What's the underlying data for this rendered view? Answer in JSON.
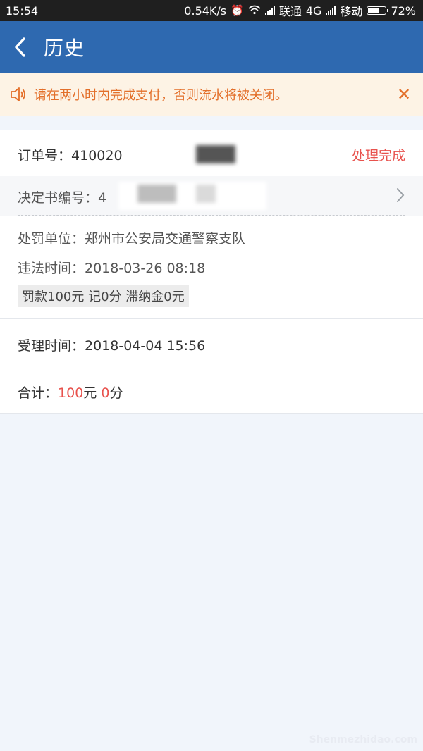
{
  "statusbar": {
    "time": "15:54",
    "speed": "0.54K/s",
    "carrier1": "联通",
    "network": "4G",
    "carrier2": "移动",
    "battery": "72%",
    "battery_level": 0.72
  },
  "appbar": {
    "title": "历史"
  },
  "notice": {
    "text": "请在两小时内完成支付，否则流水将被关闭。",
    "color": "#e36f2a"
  },
  "order": {
    "label": "订单号：",
    "number": "410020",
    "status": "处理完成",
    "decision_label": "决定书编号：",
    "decision_number": "4",
    "unit": "处罚单位：郑州市公安局交通警察支队",
    "time": "违法时间：2018-03-26 08:18",
    "fine_tag": "罚款100元 记0分 滞纳金0元"
  },
  "accept": {
    "text": "受理时间：2018-04-04 15:56"
  },
  "total": {
    "label": "合计：",
    "amount": "100",
    "yuan": "元",
    "points": "0",
    "fen": "分"
  },
  "watermark": "Shenmezhidao.com",
  "colors": {
    "appbar": "#2e69b0",
    "accent_red": "#e8524d",
    "background": "#f1f5fb"
  }
}
